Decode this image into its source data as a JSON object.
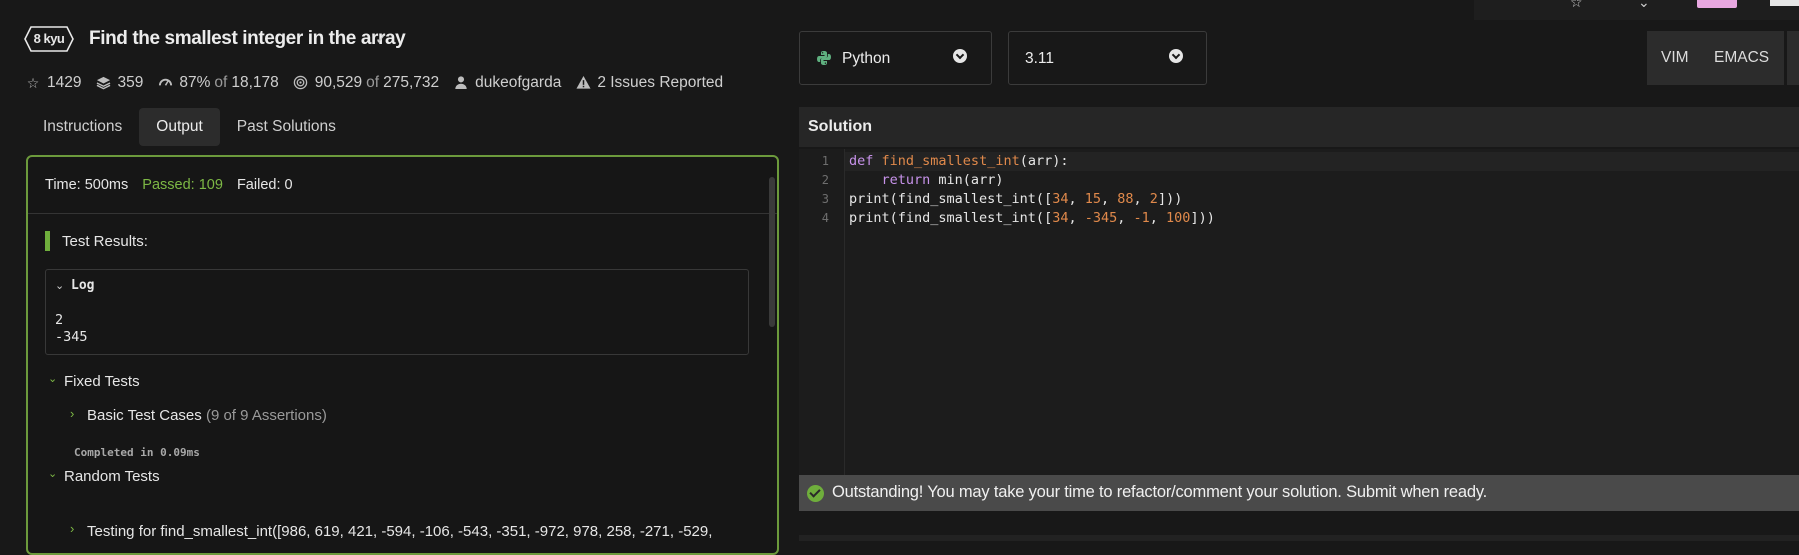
{
  "kata": {
    "rank": "8 kyu",
    "title": "Find the smallest integer in the array",
    "title_check": "✓",
    "stars": "1429",
    "collections": "359",
    "satisfaction": "87%",
    "satisfaction_of": "of",
    "satisfaction_votes": "18,178",
    "completed": "90,529",
    "completed_of": "of",
    "attempts": "275,732",
    "author": "dukeofgarda",
    "issues": "2 Issues Reported"
  },
  "tabs": [
    "Instructions",
    "Output",
    "Past Solutions"
  ],
  "active_tab": "Output",
  "output": {
    "time": "Time: 500ms",
    "passed": "Passed: 109",
    "failed": "Failed: 0",
    "results_title": "Test Results:",
    "log_label": "Log",
    "log_lines": [
      "2",
      "-345"
    ],
    "fixed_tests": "Fixed Tests",
    "basic_case": "Basic Test Cases",
    "basic_assertions": "(9 of 9 Assertions)",
    "completed_in": "Completed in 0.09ms",
    "random_tests": "Random Tests",
    "random_case": "Testing for find_smallest_int([986, 619, 421, -594, -106, -543, -351, -972, 978, 258, -271, -529,"
  },
  "editor": {
    "language": "Python",
    "version": "3.11",
    "modes": [
      "VIM",
      "EMACS"
    ],
    "solution_title": "Solution",
    "line_numbers": [
      "1",
      "2",
      "3",
      "4"
    ],
    "code": {
      "l1_kw": "def",
      "l1_fn": "find_smallest_int",
      "l1_rest": "(arr):",
      "l2_indent": "    ",
      "l2_kw": "return",
      "l2_rest": " min(arr)",
      "l3_pre": "print(find_smallest_int([",
      "l3_n1": "34",
      "l3_s1": ", ",
      "l3_n2": "15",
      "l3_s2": ", ",
      "l3_n3": "88",
      "l3_s3": ", ",
      "l3_n4": "2",
      "l3_post": "]))",
      "l4_pre": "print(find_smallest_int([",
      "l4_n1": "34",
      "l4_s1": ", ",
      "l4_n2": "-345",
      "l4_s2": ", ",
      "l4_n3": "-1",
      "l4_s3": ", ",
      "l4_n4": "100",
      "l4_post": "]))"
    },
    "success_message": "Outstanding! You may take your time to refactor/comment your solution. Submit when ready."
  },
  "colors": {
    "accent_green": "#6fae3c",
    "passed_green": "#7db845",
    "number_orange": "#e0894b",
    "keyword_purple": "#c792ea"
  },
  "icons": {
    "stars": "star-icon",
    "collections": "layers-icon",
    "satisfaction": "gauge-icon",
    "completed": "target-icon",
    "author": "user-icon",
    "issues": "warning-icon"
  }
}
